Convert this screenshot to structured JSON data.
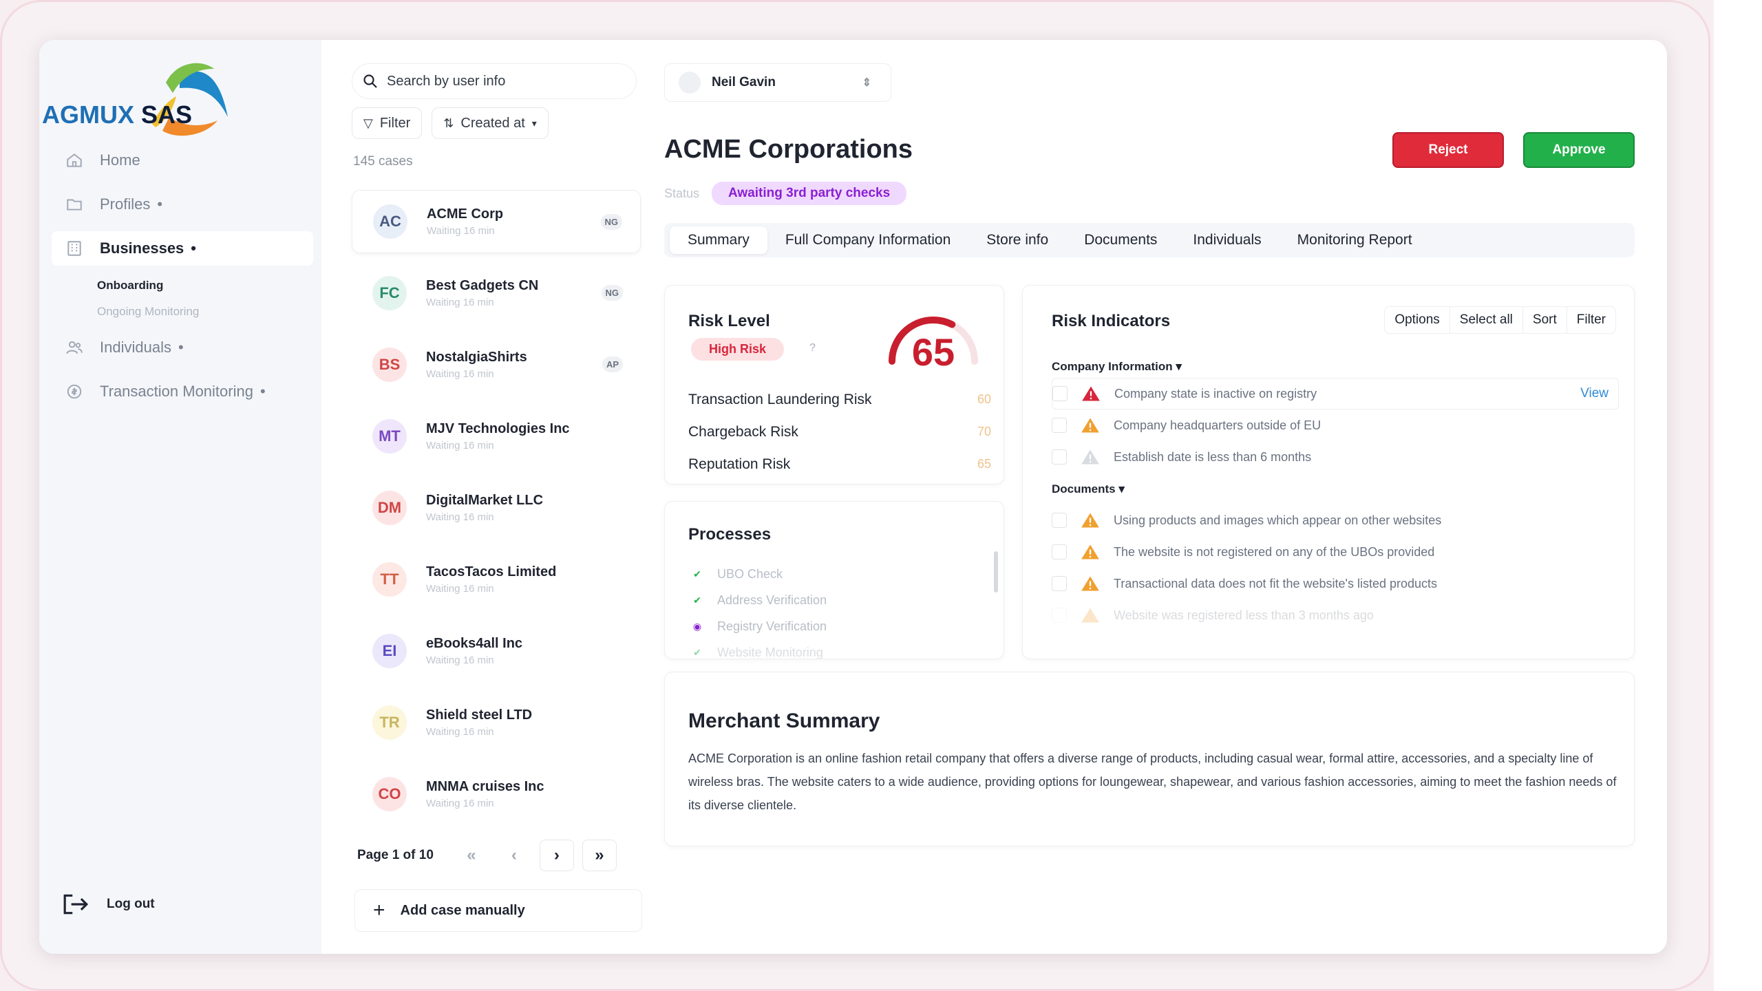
{
  "app": {
    "logo_text_a": "AGMUX",
    "logo_text_b": "SAS"
  },
  "sidebar": {
    "items": [
      {
        "label": "Home",
        "icon": "home-icon"
      },
      {
        "label": "Profiles",
        "icon": "folder-icon",
        "dot": "•"
      },
      {
        "label": "Businesses",
        "icon": "building-icon",
        "dot": "•"
      },
      {
        "label": "Individuals",
        "icon": "users-icon",
        "dot": "•"
      },
      {
        "label": "Transaction Monitoring",
        "icon": "coin-icon",
        "dot": "•"
      }
    ],
    "sub_items": [
      "Onboarding",
      "Ongoing Monitoring"
    ],
    "logout": "Log out"
  },
  "cases_panel": {
    "search_placeholder": "Search by user info",
    "filter_label": "Filter",
    "sort_label": "Created at",
    "count": "145 cases",
    "cases": [
      {
        "initials": "AC",
        "name": "ACME Corp",
        "sub": "Waiting 16 min",
        "badge": "NG",
        "bg": "#e8eef8",
        "fg": "#4a5a80"
      },
      {
        "initials": "FC",
        "name": "Best Gadgets CN",
        "sub": "Waiting 16 min",
        "badge": "NG",
        "bg": "#e3f4ee",
        "fg": "#2a8a6a"
      },
      {
        "initials": "BS",
        "name": "NostalgiaShirts",
        "sub": "Waiting 16 min",
        "badge": "AP",
        "bg": "#fde4e4",
        "fg": "#d04646"
      },
      {
        "initials": "MT",
        "name": "MJV Technologies Inc",
        "sub": "Waiting 16 min",
        "badge": "",
        "bg": "#efe6fb",
        "fg": "#7a4ac0"
      },
      {
        "initials": "DM",
        "name": "DigitalMarket LLC",
        "sub": "Waiting 16 min",
        "badge": "",
        "bg": "#fde4e4",
        "fg": "#d04646"
      },
      {
        "initials": "TT",
        "name": "TacosTacos Limited",
        "sub": "Waiting 16 min",
        "badge": "",
        "bg": "#fde8e4",
        "fg": "#d06046"
      },
      {
        "initials": "EI",
        "name": "eBooks4all Inc",
        "sub": "Waiting 16 min",
        "badge": "",
        "bg": "#ece8fb",
        "fg": "#5a4ac0"
      },
      {
        "initials": "TR",
        "name": "Shield steel LTD",
        "sub": "Waiting 16 min",
        "badge": "",
        "bg": "#fbf6dc",
        "fg": "#c8b460"
      },
      {
        "initials": "CO",
        "name": "MNMA cruises Inc",
        "sub": "Waiting 16 min",
        "badge": "",
        "bg": "#fde4e4",
        "fg": "#d04646"
      }
    ],
    "page_label": "Page 1 of 10",
    "pager": {
      "first": "«",
      "prev": "‹",
      "next": "›",
      "last": "»"
    },
    "add_case": "Add case manually"
  },
  "main": {
    "user_name": "Neil Gavin",
    "title": "ACME Corporations",
    "status_label": "Status",
    "status_value": "Awaiting 3rd party checks",
    "reject": "Reject",
    "approve": "Approve",
    "tabs": [
      "Summary",
      "Full Company Information",
      "Store info",
      "Documents",
      "Individuals",
      "Monitoring Report"
    ],
    "risk": {
      "title": "Risk Level",
      "pill": "High Risk",
      "help": "?",
      "score": "65",
      "score_fraction": 0.65,
      "rows": [
        {
          "label": "Transaction Laundering Risk",
          "value": "60"
        },
        {
          "label": "Chargeback Risk",
          "value": "70"
        },
        {
          "label": "Reputation Risk",
          "value": "65"
        }
      ]
    },
    "processes": {
      "title": "Processes",
      "items": [
        {
          "label": "UBO Check",
          "state": "done"
        },
        {
          "label": "Address Verification",
          "state": "done"
        },
        {
          "label": "Registry Verification",
          "state": "active"
        },
        {
          "label": "Website Monitoring",
          "state": "done"
        }
      ]
    },
    "indicators": {
      "title": "Risk Indicators",
      "actions": [
        "Options",
        "Select all",
        "Sort",
        "Filter"
      ],
      "company_section": "Company Information",
      "company_items": [
        {
          "label": "Company state is inactive on registry",
          "level": "high",
          "link": "View"
        },
        {
          "label": "Company headquarters outside of EU",
          "level": "medium"
        },
        {
          "label": "Establish date is less than 6 months",
          "level": "low"
        }
      ],
      "documents_section": "Documents",
      "documents_items": [
        {
          "label": "Using products and images which appear on other websites",
          "level": "medium"
        },
        {
          "label": "The website is not registered on any of the UBOs provided",
          "level": "medium"
        },
        {
          "label": "Transactional data does not fit the website's listed products",
          "level": "medium"
        },
        {
          "label": "Website was registered less than 3 months ago",
          "level": "faded"
        }
      ]
    },
    "merchant": {
      "title": "Merchant Summary",
      "text": "ACME Corporation is an online fashion retail company that offers a diverse range of products, including casual wear, formal attire, accessories, and a specialty line of wireless bras. The website caters to a wide audience, providing options for loungewear, shapewear, and various fashion accessories, aiming to meet the fashion needs of its diverse clientele."
    }
  },
  "colors": {
    "reject": "#e02b3b",
    "approve": "#22b04b",
    "accent_purple": "#8a1fd1",
    "risk_red": "#c81e2e",
    "warn_orange": "#f0a030"
  }
}
